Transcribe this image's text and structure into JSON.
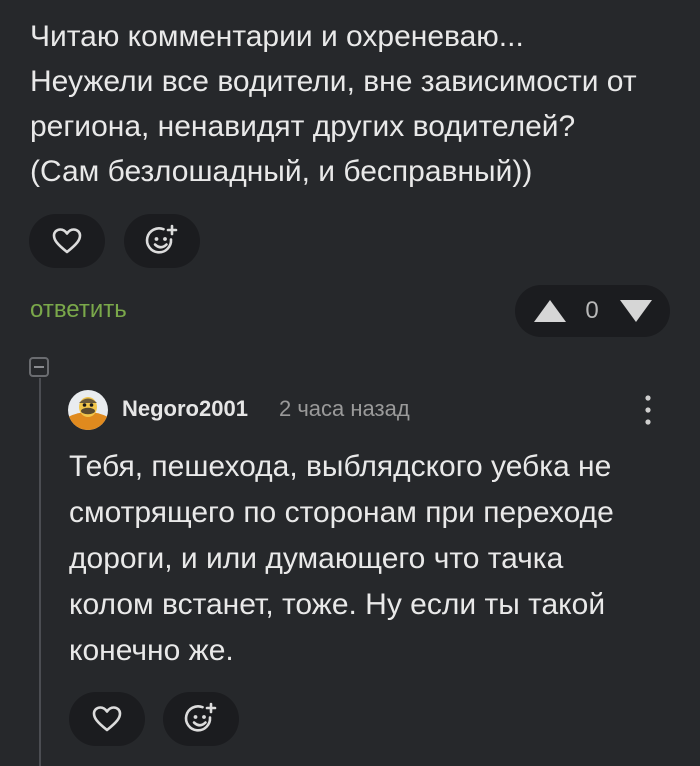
{
  "post": {
    "text": "Читаю комментарии и охреневаю...\nНеужели все водители, вне зависимости от\nрегиона, ненавидят других водителей?\n(Сам безлошадный, и бесправный))"
  },
  "actions": {
    "like_icon": "heart-icon",
    "react_icon": "smiley-add-icon",
    "reply_label": "ответить"
  },
  "rating": {
    "score": "0",
    "up_icon": "triangle-up-icon",
    "down_icon": "triangle-down-icon"
  },
  "comment": {
    "username": "Negoro2001",
    "timestamp": "2 часа назад",
    "text": "Тебя, пешехода, выблядского уебка не\nсмотрящего по сторонам при переходе\nдороги, и или думающего что тачка\nколом встанет, тоже. Ну если ты такой\nконечно же."
  },
  "colors": {
    "background": "#26282b",
    "pill": "#1b1c1f",
    "reply": "#7aa84a",
    "text": "#e9e9e9",
    "muted": "#9a9a9a"
  }
}
